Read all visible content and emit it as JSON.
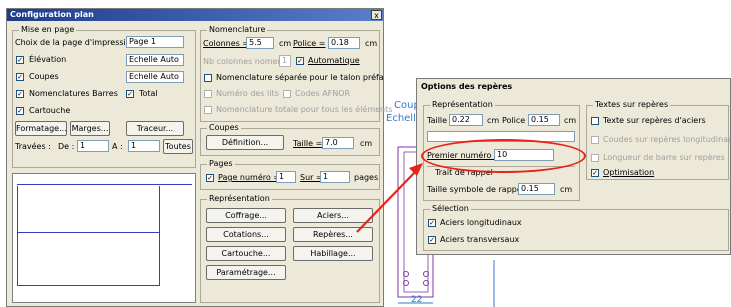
{
  "config": {
    "title": "Configuration plan",
    "close": "x",
    "mise_en_page": {
      "legend": "Mise en page",
      "choix_label": "Choix de la page d'impression",
      "choix_value": "Page 1",
      "elevation_label": "Élévation",
      "elevation_value": "Echelle Auto",
      "elevation_checked": "✓",
      "coupes_label": "Coupes",
      "coupes_value": "Echelle Auto",
      "coupes_checked": "✓",
      "nomenclatures_label": "Nomenclatures Barres",
      "nomenclatures_checked": "✓",
      "total_label": "Total",
      "total_checked": "✓",
      "cartouche_label": "Cartouche",
      "cartouche_checked": "✓",
      "formatage_btn": "Formatage...",
      "marges_btn": "Marges...",
      "traceur_btn": "Traceur...",
      "travees_label": "Travées :",
      "de_label": "De :",
      "de_value": "1",
      "a_label": "A :",
      "a_value": "1",
      "toutes_btn": "Toutes"
    },
    "nomenclature": {
      "legend": "Nomenclature",
      "colonnes_label": "Colonnes =",
      "colonnes_value": "5.5",
      "cm1": "cm",
      "police_label": "Police =",
      "police_value": "0.18",
      "cm2": "cm",
      "nb_colonnes_label": "Nb colonnes nomen =",
      "nb_colonnes_value": "1",
      "automatique_label": "Automatique",
      "automatique_checked": "✓",
      "separee_label": "Nomenclature séparée pour le talon préfa",
      "numero_lits_label": "Numéro des lits",
      "codes_afnor_label": "Codes AFNOR",
      "totale_label": "Nomenclature totale pour tous les éléments"
    },
    "coupes": {
      "legend": "Coupes",
      "definition_btn": "Définition...",
      "taille_label": "Taille =",
      "taille_value": "7.0",
      "cm": "cm"
    },
    "pages": {
      "legend": "Pages",
      "page_numero_label": "Page numéro =",
      "page_numero_value": "1",
      "page_numero_checked": "✓",
      "sur_label": "Sur =",
      "sur_value": "1",
      "pages_label": "pages"
    },
    "representation": {
      "legend": "Représentation",
      "coffrage_btn": "Coffrage...",
      "aciers_btn": "Aciers...",
      "cotations_btn": "Cotations...",
      "reperes_btn": "Repères...",
      "cartouche_btn": "Cartouche...",
      "habillage_btn": "Habillage...",
      "parametrage_btn": "Paramétrage..."
    }
  },
  "options": {
    "title": "Options des repères",
    "representation": {
      "legend": "Représentation",
      "taille_label": "Taille",
      "taille_value": "0.22",
      "cm1": "cm",
      "police_label": "Police",
      "police_value": "0.15",
      "cm2": "cm",
      "premier_label": "Premier numéro =",
      "premier_value": "10",
      "trait_label": "Trait de rappel",
      "taille_symbole_label": "Taille symbole de rappel",
      "taille_symbole_value": "0.15",
      "cm3": "cm"
    },
    "textes": {
      "legend": "Textes sur repères",
      "texte_aciers_label": "Texte sur repères d'aciers",
      "coudes_label": "Coudes sur repères longitudinaux",
      "longueur_label": "Longueur de barre sur repères",
      "optimisation_label": "Optimisation",
      "optimisation_checked": "✓"
    },
    "selection": {
      "legend": "Sélection",
      "longitudinaux_label": "Aciers longitudinaux",
      "longitudinaux_checked": "✓",
      "transversaux_label": "Aciers transversaux",
      "transversaux_checked": "✓"
    }
  },
  "background": {
    "coup_text": "Coup",
    "echell_text": "Echell",
    "dim_text": "22"
  },
  "colors": {
    "highlight": "#e8231a",
    "drawing_blue": "#3a78c8",
    "drawing_purple": "#7a3aa0"
  }
}
